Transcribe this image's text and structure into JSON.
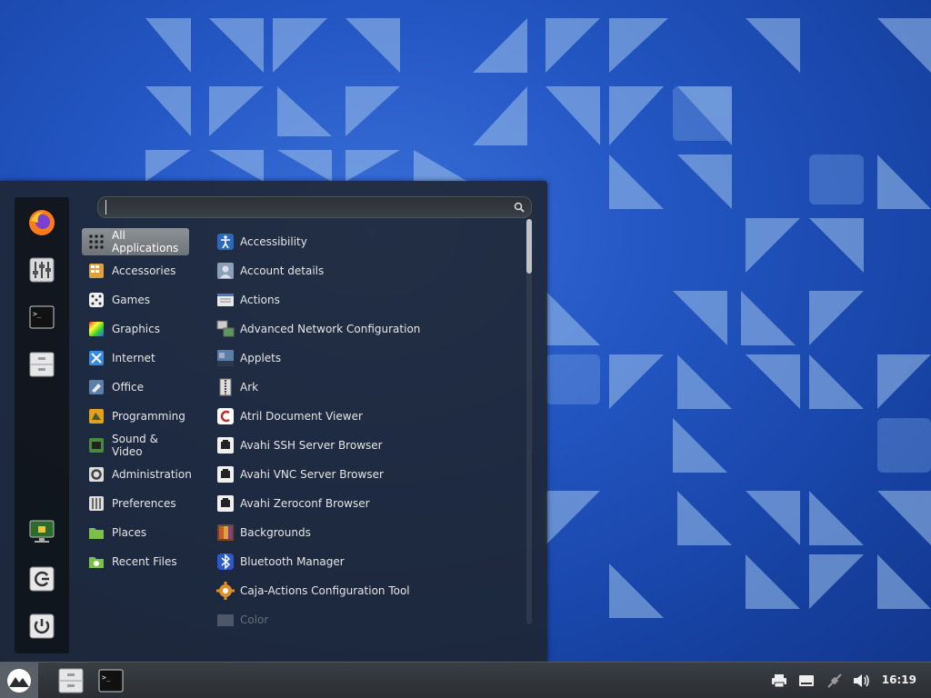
{
  "colors": {
    "menu_bg": "#1e242c",
    "active_category": "#7d8287",
    "taskbar_bg": "#2f3338",
    "wallpaper": "#2457c4"
  },
  "search": {
    "placeholder": "",
    "value": "",
    "icon": "search-icon"
  },
  "favorites": [
    {
      "name": "firefox",
      "icon": "firefox-icon"
    },
    {
      "name": "settings",
      "icon": "settings-sliders-icon"
    },
    {
      "name": "terminal",
      "icon": "terminal-icon"
    },
    {
      "name": "files",
      "icon": "file-cabinet-icon"
    }
  ],
  "session": [
    {
      "name": "lock-screen",
      "icon": "lock-screen-icon"
    },
    {
      "name": "logout",
      "icon": "logout-icon"
    },
    {
      "name": "shutdown",
      "icon": "power-icon"
    }
  ],
  "categories": [
    {
      "label": "All Applications",
      "active": true
    },
    {
      "label": "Accessories"
    },
    {
      "label": "Games"
    },
    {
      "label": "Graphics"
    },
    {
      "label": "Internet"
    },
    {
      "label": "Office"
    },
    {
      "label": "Programming"
    },
    {
      "label": "Sound & Video"
    },
    {
      "label": "Administration"
    },
    {
      "label": "Preferences"
    },
    {
      "label": "Places"
    },
    {
      "label": "Recent Files"
    }
  ],
  "apps": [
    {
      "label": "Accessibility"
    },
    {
      "label": "Account details"
    },
    {
      "label": "Actions"
    },
    {
      "label": "Advanced Network Configuration"
    },
    {
      "label": "Applets"
    },
    {
      "label": "Ark"
    },
    {
      "label": "Atril Document Viewer"
    },
    {
      "label": "Avahi SSH Server Browser"
    },
    {
      "label": "Avahi VNC Server Browser"
    },
    {
      "label": "Avahi Zeroconf Browser"
    },
    {
      "label": "Backgrounds"
    },
    {
      "label": "Bluetooth Manager"
    },
    {
      "label": "Caja-Actions Configuration Tool"
    },
    {
      "label": "Color"
    }
  ],
  "taskbar": {
    "clock": "16:19",
    "launchers": [
      {
        "name": "menu",
        "icon": "cinnamon-menu-icon"
      },
      {
        "name": "files",
        "icon": "file-cabinet-icon"
      },
      {
        "name": "terminal",
        "icon": "terminal-icon"
      }
    ],
    "tray": [
      {
        "name": "printer",
        "icon": "printer-icon"
      },
      {
        "name": "keyboard",
        "icon": "keyboard-icon"
      },
      {
        "name": "network",
        "icon": "network-disconnected-icon"
      },
      {
        "name": "volume",
        "icon": "volume-icon"
      }
    ]
  }
}
